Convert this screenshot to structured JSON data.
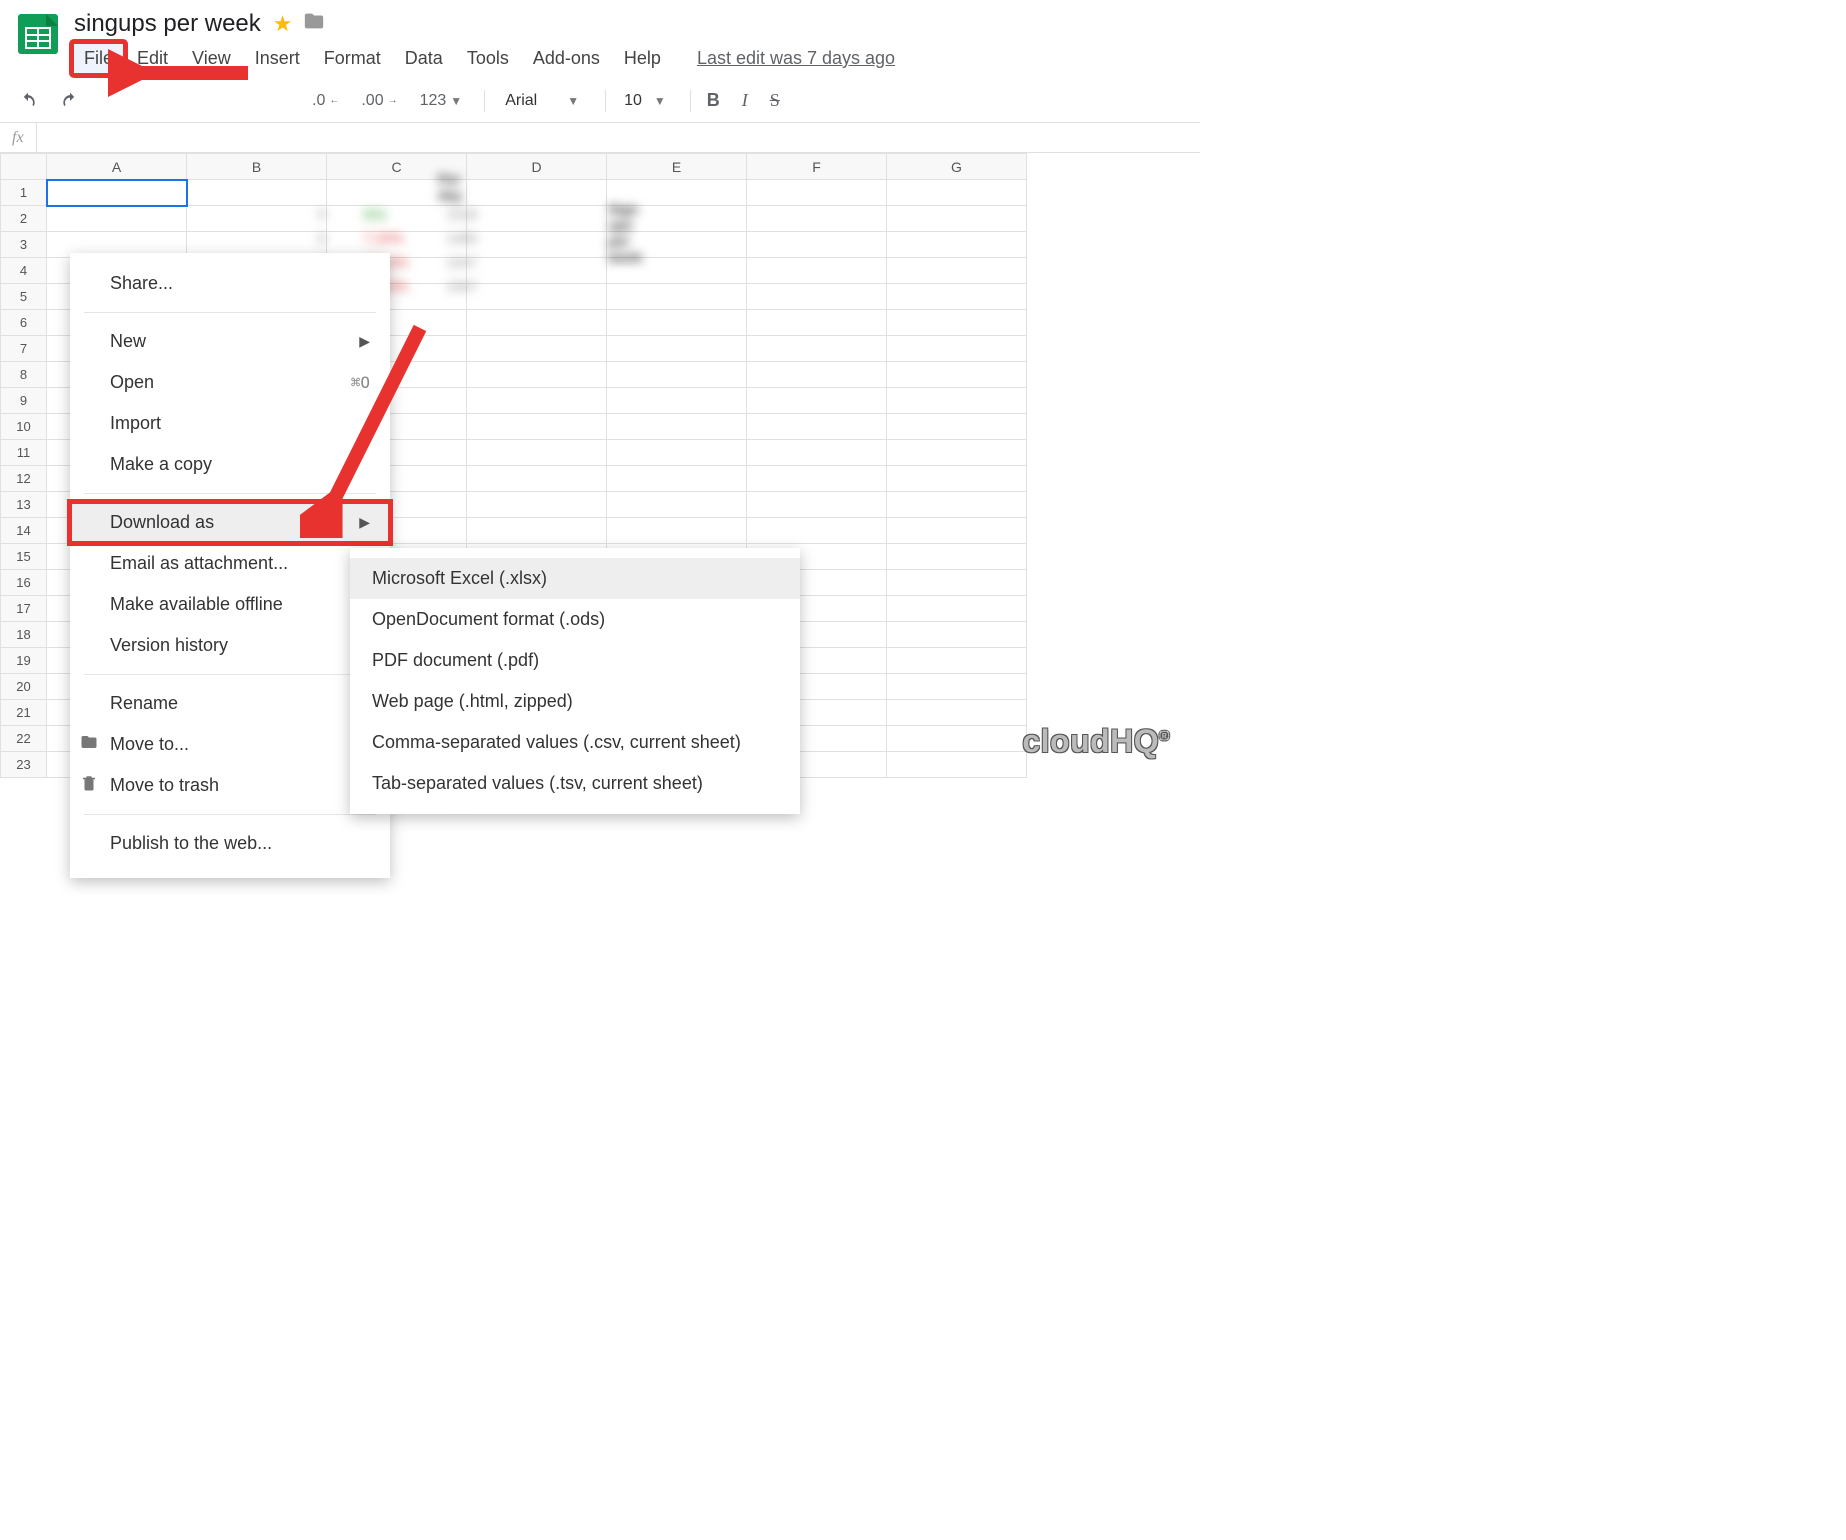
{
  "doc": {
    "title": "singups per week"
  },
  "menubar": {
    "items": [
      "File",
      "Edit",
      "View",
      "Insert",
      "Format",
      "Data",
      "Tools",
      "Add-ons",
      "Help"
    ],
    "last_edit": "Last edit was 7 days ago"
  },
  "toolbar": {
    "decimal_dec": ".0",
    "decimal_inc": ".00",
    "number_fmt": "123",
    "font": "Arial",
    "font_size": "10",
    "bold": "B",
    "italic": "I",
    "strike": "S"
  },
  "formula_bar": {
    "fx": "fx"
  },
  "columns": [
    "",
    "A",
    "B",
    "C",
    "D",
    "E",
    "F",
    "G"
  ],
  "rows": [
    1,
    2,
    3,
    4,
    5,
    6,
    7,
    8,
    9,
    10,
    11,
    12,
    13,
    14,
    15,
    16,
    17,
    18,
    19,
    20,
    21,
    22,
    23
  ],
  "file_menu": {
    "share": "Share...",
    "new": "New",
    "open": "Open",
    "open_shortcut": "⌘O",
    "import": "Import",
    "make_copy": "Make a copy",
    "download_as": "Download as",
    "email_attachment": "Email as attachment...",
    "make_available_offline": "Make available offline",
    "version_history": "Version history",
    "rename": "Rename",
    "move_to": "Move to...",
    "move_to_trash": "Move to trash",
    "publish_web": "Publish to the web..."
  },
  "download_submenu": {
    "xlsx": "Microsoft Excel (.xlsx)",
    "ods": "OpenDocument format (.ods)",
    "pdf": "PDF document (.pdf)",
    "html": "Web page (.html, zipped)",
    "csv": "Comma-separated values (.csv, current sheet)",
    "tsv": "Tab-separated values (.tsv, current sheet)"
  },
  "branding": "cloudHQ"
}
